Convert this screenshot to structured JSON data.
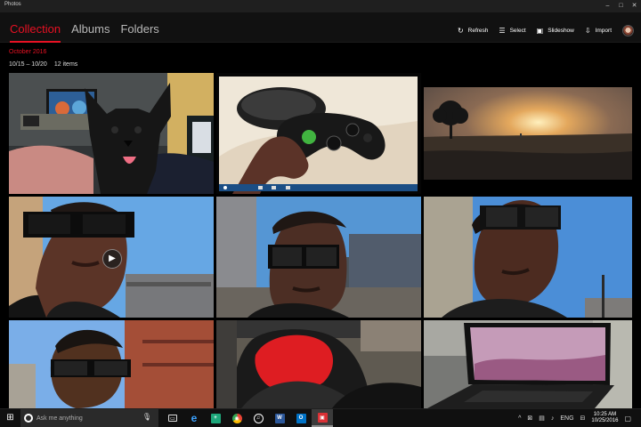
{
  "window": {
    "title": "Photos",
    "controls": [
      "minimize",
      "maximize",
      "close"
    ],
    "control_glyphs": [
      "–",
      "□",
      "✕"
    ]
  },
  "nav": {
    "tabs": [
      {
        "label": "Collection",
        "active": true
      },
      {
        "label": "Albums",
        "active": false
      },
      {
        "label": "Folders",
        "active": false
      }
    ]
  },
  "toolbar": {
    "refresh_label": "Refresh",
    "select_label": "Select",
    "slideshow_label": "Slideshow",
    "import_label": "Import"
  },
  "collection": {
    "section_title": "October 2016",
    "date_range": "10/15 – 10/20",
    "item_count": "12 items"
  },
  "photos": [
    {
      "name": "photo-dog",
      "subject": "black puppy on a bed",
      "is_video": false
    },
    {
      "name": "photo-xbox-controller",
      "subject": "hand holding an Xbox controller",
      "is_video": false
    },
    {
      "name": "photo-sunset-field",
      "subject": "sunset over a field",
      "is_video": false
    },
    {
      "name": "photo-selfie-1",
      "subject": "man with sunglasses, video",
      "is_video": true
    },
    {
      "name": "photo-selfie-2",
      "subject": "man with sunglasses near brick buildings",
      "is_video": false
    },
    {
      "name": "photo-selfie-3",
      "subject": "man with sunglasses outdoors",
      "is_video": false
    },
    {
      "name": "photo-selfie-4",
      "subject": "man with sunglasses near brick wall",
      "is_video": false
    },
    {
      "name": "photo-backpack",
      "subject": "red and black backpack",
      "is_video": false
    },
    {
      "name": "photo-laptop",
      "subject": "laptop on a desk",
      "is_video": false
    }
  ],
  "taskbar": {
    "search_placeholder": "Ask me anything",
    "icons": [
      "start",
      "cortana",
      "microphone",
      "task-view",
      "edge",
      "store",
      "chrome",
      "groove",
      "word",
      "outlook",
      "photos"
    ],
    "start_glyph": "⊞",
    "mic_glyph": "🎙",
    "app_glyphs": [
      "▭",
      "e",
      "+",
      "◉",
      "♫",
      "W",
      "O",
      "▣"
    ],
    "tray_glyphs": [
      "^",
      "⊠",
      "▤",
      "♪",
      "ENG",
      "⊟"
    ],
    "notification_glyph": "▢",
    "clock_time": "10:25 AM",
    "clock_date": "10/25/2016"
  },
  "colors": {
    "accent": "#e81123",
    "background": "#000000",
    "header": "#111111",
    "taskbar": "#101010"
  }
}
